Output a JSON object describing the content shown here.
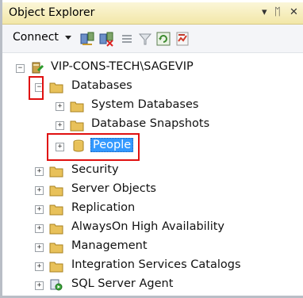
{
  "window": {
    "title": "Object Explorer",
    "controls": {
      "dropdown_icon": "dropdown-arrow-icon",
      "pin_icon": "pin-icon",
      "close_icon": "close-icon"
    }
  },
  "toolbar": {
    "connect_label": "Connect",
    "icons": [
      "connect-dropdown-icon",
      "connect-server-icon",
      "disconnect-icon",
      "stop-icon",
      "filter-icon",
      "refresh-icon",
      "activity-monitor-icon"
    ]
  },
  "tree": {
    "server": "VIP-CONS-TECH\\SAGEVIP",
    "databases": "Databases",
    "system_databases": "System Databases",
    "database_snapshots": "Database Snapshots",
    "people": "People",
    "security": "Security",
    "server_objects": "Server Objects",
    "replication": "Replication",
    "alwayson": "AlwaysOn High Availability",
    "management": "Management",
    "integration_services": "Integration Services Catalogs",
    "sql_server_agent": "SQL Server Agent"
  },
  "colors": {
    "selection": "#3399ff",
    "highlight_box": "#e01010",
    "folder": "#e8c15a",
    "titlebar": "#f2e7a8"
  }
}
